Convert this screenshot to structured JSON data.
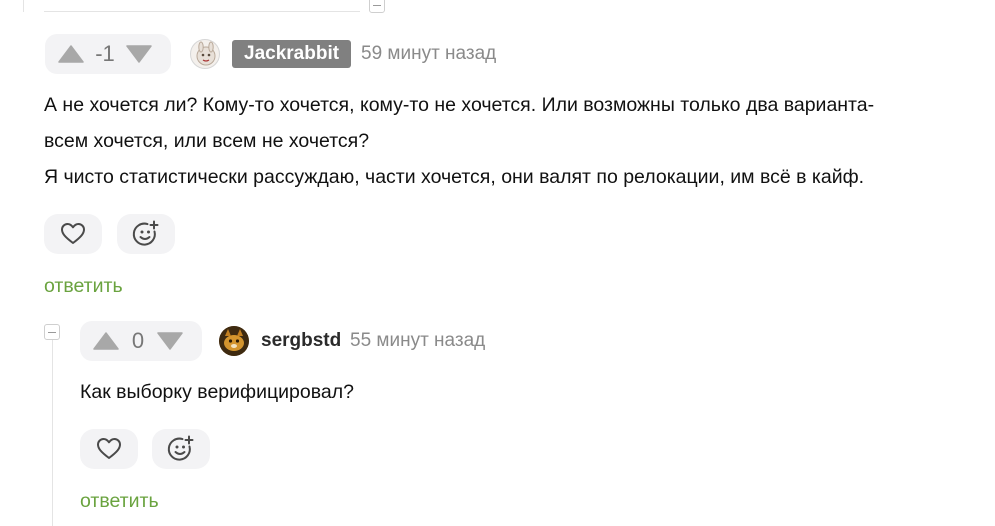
{
  "comment1": {
    "score": "-1",
    "username": "Jackrabbit",
    "time": "59 минут назад",
    "lines": [
      "А не хочется ли? Кому-то хочется, кому-то не хочется. Или возможны только два варианта-",
      "всем хочется, или всем не хочется?",
      "Я чисто статистически рассуждаю, части хочется, они валят по релокации, им всё в кайф."
    ],
    "reply_label": "ответить"
  },
  "comment2": {
    "score": "0",
    "username": "sergbstd",
    "time": "55 минут назад",
    "text": "Как выборку верифицировал?",
    "reply_label": "ответить"
  },
  "icons": {
    "upvote": "upvote-arrow-icon",
    "downvote": "downvote-arrow-icon",
    "like": "heart-icon",
    "reaction": "smiley-add-icon",
    "collapse": "collapse-minus-icon"
  },
  "colors": {
    "reply_link": "#6aa33f",
    "badge_bg": "#808080",
    "pill_bg": "#f3f3f5",
    "muted": "#8a8a8a"
  }
}
